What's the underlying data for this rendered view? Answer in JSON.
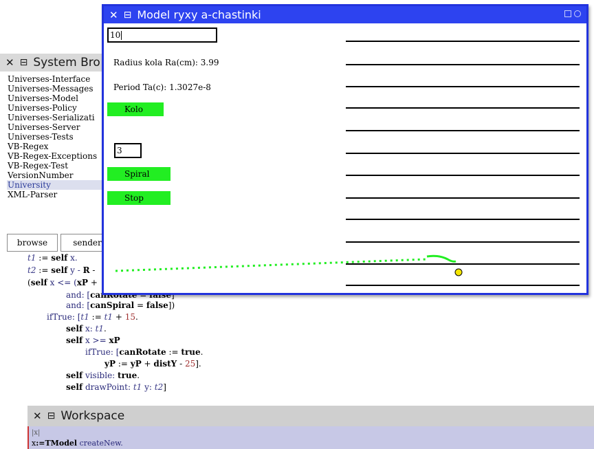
{
  "system_browser": {
    "title": "System Bro",
    "packages": [
      "Universes-Interface",
      "Universes-Messages",
      "Universes-Model",
      "Universes-Policy",
      "Universes-Serializati",
      "Universes-Server",
      "Universes-Tests",
      "VB-Regex",
      "VB-Regex-Exceptions",
      "VB-Regex-Test",
      "VersionNumber",
      "University",
      "XML-Parser"
    ],
    "selected_index": 11,
    "buttons": {
      "browse": "browse",
      "senders": "sender:"
    },
    "code": {
      "l1": {
        "a": "t1",
        "b": " := ",
        "c": "self",
        "d": " x."
      },
      "l2": {
        "a": "t2",
        "b": " := ",
        "c": "self",
        "d": " y - ",
        "e": "R",
        "f": " -"
      },
      "l3": {
        "a": "(",
        "b": "self",
        "c": " x <= (",
        "d": "xP",
        "e": " + "
      },
      "l4": {
        "a": "and: [",
        "b": "canRotate",
        "c": " = ",
        "d": "false",
        "e": "]"
      },
      "l5": {
        "a": "and: [",
        "b": "canSpiral",
        "c": " = ",
        "d": "false",
        "e": "])"
      },
      "l6": {
        "a": "ifTrue: [",
        "b": "t1",
        "c": " := ",
        "d": "t1",
        "e": " + ",
        "f": "15",
        "g": "."
      },
      "l7": {
        "a": "self",
        "b": " x: ",
        "c": "t1",
        "d": "."
      },
      "l8": {
        "a": "self",
        "b": " x >= ",
        "c": "xP"
      },
      "l9": {
        "a": "ifTrue: [",
        "b": "canRotate",
        "c": " := ",
        "d": "true",
        "e": "."
      },
      "l10": {
        "a": "yP",
        "b": " := ",
        "c": "yP",
        "d": " + ",
        "e": "distY",
        "f": " - ",
        "g": "25",
        "h": "]."
      },
      "l11": {
        "a": "self",
        "b": " visible: ",
        "c": "true",
        "d": "."
      },
      "l12": {
        "a": "self",
        "b": " drawPoint: ",
        "c": "t1",
        "d": " y: ",
        "e": "t2",
        "f": "]"
      }
    }
  },
  "model_window": {
    "title": "Model ryxy a-chastinki",
    "radius_input": "10",
    "radius_label": "Radius kola Ra(cm): 3.99",
    "period_label": "Period Ta(c): 1.3027e-8",
    "kolo_button": "Kolo",
    "spiral_input": "3",
    "spiral_button": "Spiral",
    "stop_button": "Stop",
    "colors": {
      "title_bar": "#2d43f0",
      "button": "#22ee22",
      "trail": "#22ee22",
      "point": "#f5e600"
    }
  },
  "workspace": {
    "title": "Workspace",
    "line1": "|x|",
    "line2_var": "x",
    "line2_assign": ":=",
    "line2_class": "TModel",
    "line2_msg": " createNew."
  },
  "icons": [
    "close-icon",
    "window-menu-icon",
    "collapse-icon",
    "expand-icon",
    "text-cursor-icon"
  ]
}
